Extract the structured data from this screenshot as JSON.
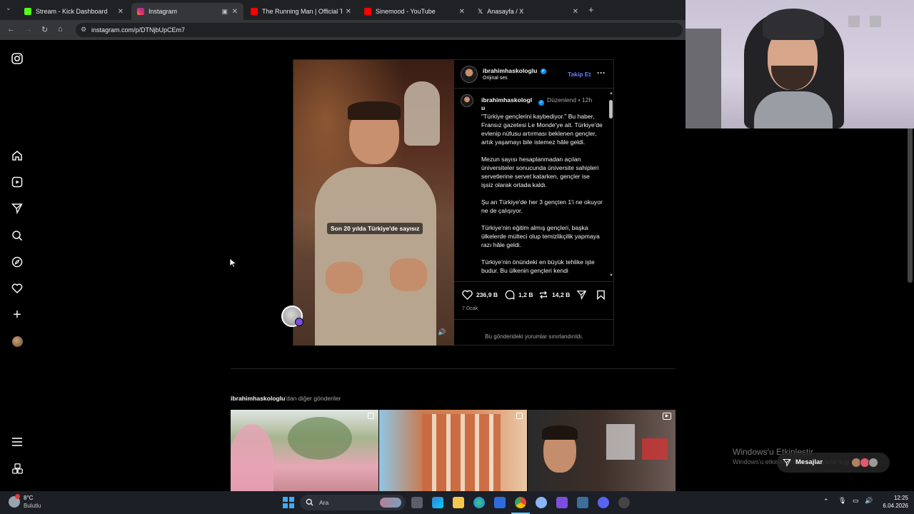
{
  "browser": {
    "tabs": [
      {
        "title": "Stream - Kick Dashboard",
        "color": "#53fc18"
      },
      {
        "title": "Instagram",
        "color": "#e1306c"
      },
      {
        "title": "The Running Man | Official Trai",
        "color": "#ff0000"
      },
      {
        "title": "Sinemood - YouTube",
        "color": "#ff0000"
      },
      {
        "title": "Anasayfa / X",
        "color": "#ffffff"
      }
    ],
    "url": "instagram.com/p/DTNjbUpCEm7"
  },
  "post": {
    "username": "ibrahimhaskologlu",
    "audio": "Orijinal ses",
    "follow": "Takip Et",
    "caption_user": "ibrahimhaskologl u",
    "edited": "Düzenlend",
    "time": "12h",
    "subtitle": "Son 20 yılda Türkiye'de sayısız",
    "caption": [
      "\"Türkiye gençlerini kaybediyor.\" Bu haber, Fransız gazetesi Le Monde'ye ait. Türkiye'de evlenip nüfusu artırması beklenen gençler, artık yaşamayı bile istemez hâle geldi.",
      "Mezun sayısı hesaplanmadan açılan üniversiteler sonucunda üniversite sahipleri servetlerine servet katarken, gençler ise işsiz olarak ortada kaldı.",
      "Şu an Türkiye'de her 3 gençten 1'i ne okuyor ne de çalışıyor.",
      "Türkiye'nin eğitim almış gençleri, başka ülkelerde mülteci olup temizlikçilik yapmaya razı hâle geldi.",
      "Türkiye'nin önündeki en büyük tehlike işte budur. Bu ülkenin gençleri kendi"
    ],
    "likes": "236,9 B",
    "comments": "1,2 B",
    "reposts": "14,2 B",
    "date": "7 Ocak",
    "comments_limited": "Bu gönderideki yorumlar sınırlandırıldı."
  },
  "more": {
    "user": "ibrahimhaskologlu",
    "suffix": "'dan diğer gönderiler"
  },
  "overlay": {
    "activate_title": "Windows'u Etkinleştir",
    "activate_sub": "Windows'u etkinleştirmek için Ayarlar'a gidin.",
    "messages": "Mesajlar"
  },
  "taskbar": {
    "temp": "8°C",
    "weather": "Bulutlu",
    "search": "Ara",
    "time": "12:25",
    "date": "6.04.2026"
  }
}
